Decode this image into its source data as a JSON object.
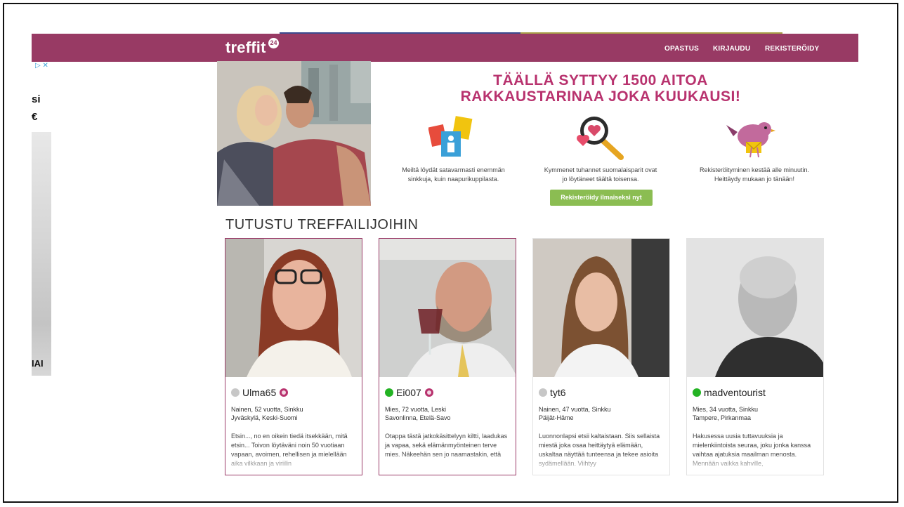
{
  "brand": {
    "name": "treffit",
    "badge": "24",
    "color": "#983a64"
  },
  "nav": {
    "items": [
      "OPASTUS",
      "KIRJAUDU",
      "REKISTERÖIDY"
    ]
  },
  "ad": {
    "choices": "▷ ✕",
    "text1": "si",
    "text2": "€",
    "text3": "IAI"
  },
  "hero": {
    "title_line1": "TÄÄLLÄ SYTTYY 1500 AITOA",
    "title_line2": "RAKKAUSTARINAA JOKA KUUKAUSI!",
    "features": [
      {
        "icon": "profile-cards-icon",
        "line1": "Meiltä löydät satavarmasti enemmän",
        "line2": "sinkkuja, kuin naapurikuppilasta."
      },
      {
        "icon": "magnifier-heart-icon",
        "line1": "Kymmenet tuhannet suomalaisparit ovat",
        "line2": "jo löytäneet täältä toisensa."
      },
      {
        "icon": "bird-letter-icon",
        "line1": "Rekisteröityminen kestää alle minuutin.",
        "line2": "Heittäydy mukaan jo tänään!"
      }
    ],
    "cta": "Rekisteröidy ilmaiseksi nyt"
  },
  "section": {
    "title": "TUTUSTU TREFFAILIJOIHIN"
  },
  "profiles": [
    {
      "name": "Ulma65",
      "online": false,
      "vip": true,
      "info1": "Nainen, 52 vuotta, Sinkku",
      "info2": "Jyväskylä, Keski-Suomi",
      "desc": "Etsin..., no en oikein tiedä itsekkään, mitä etsin... Toivon löytäväni noin 50 vuotiaan vapaan, avoimen, rehellisen ja mielellään aika vilkkaan ja viriilin"
    },
    {
      "name": "Ei007",
      "online": true,
      "vip": true,
      "info1": "Mies, 72 vuotta, Leski",
      "info2": "Savonlinna, Etelä-Savo",
      "desc": "Otappa tästä jatkokäsittelyyn kiltti, laadukas ja vapaa, sekä elämänmyönteinen terve mies. Näkeehän sen jo naamastakin, että"
    },
    {
      "name": "tyt6",
      "online": false,
      "vip": false,
      "info1": "Nainen, 47 vuotta, Sinkku",
      "info2": "Päijät-Häme",
      "desc": "Luonnonlapsi etsii kaltaistaan. Siis sellaista miestä joka osaa heittäytyä elämään, uskaltaa näyttää tunteensa ja tekee asioita sydämellään. Viihtyy"
    },
    {
      "name": "madventourist",
      "online": true,
      "vip": false,
      "info1": "Mies, 34 vuotta, Sinkku",
      "info2": "Tampere, Pirkanmaa",
      "desc": "Hakusessa uusia tuttavuuksia ja mielenkiintoista seuraa, joku jonka kanssa vaihtaa ajatuksia maailman menosta. Mennään vaikka kahville,"
    }
  ],
  "colors": {
    "accent": "#b8326e",
    "cta": "#8bbd52",
    "online": "#23b323",
    "offline": "#c7c7c7"
  }
}
